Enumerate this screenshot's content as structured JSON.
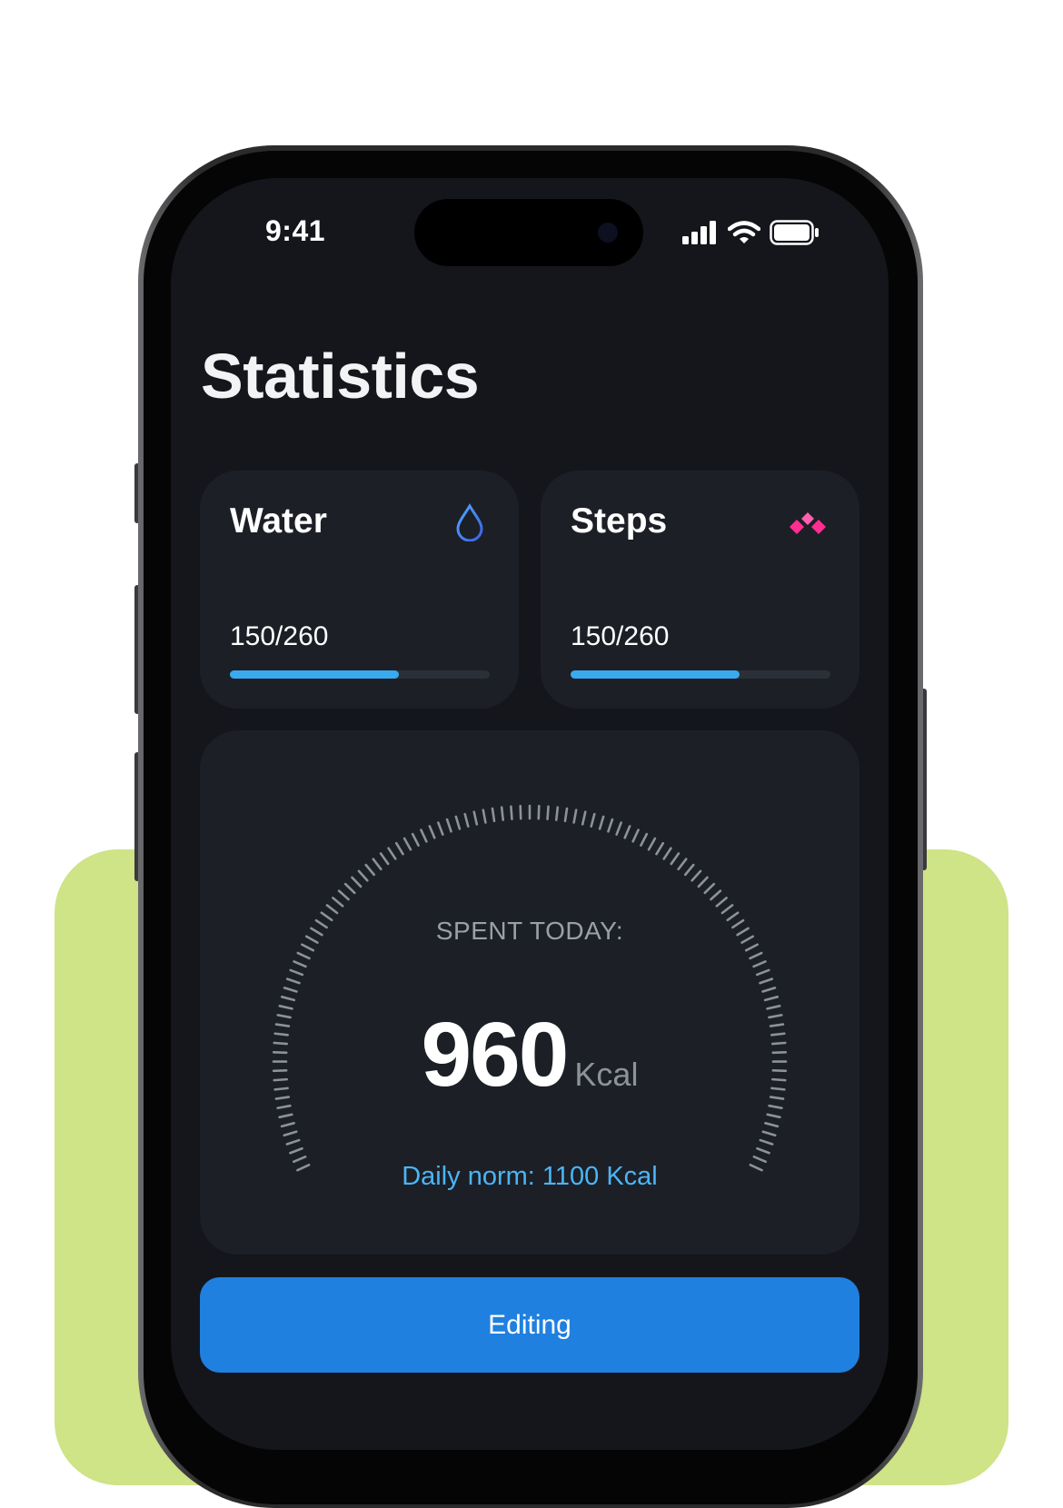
{
  "status_bar": {
    "time": "9:41"
  },
  "page": {
    "title": "Statistics"
  },
  "cards": [
    {
      "label": "Water",
      "icon": "water-drop-icon",
      "value": "150/260",
      "progress": 0.65
    },
    {
      "label": "Steps",
      "icon": "steps-diamond-icon",
      "value": "150/260",
      "progress": 0.65
    }
  ],
  "calories": {
    "spent_label": "SPENT TODAY:",
    "value": "960",
    "unit": "Kcal",
    "norm_text": "Daily norm: 1100 Kcal"
  },
  "actions": {
    "edit_label": "Editing"
  },
  "colors": {
    "accent_blue": "#1f80df",
    "progress_blue": "#39aaf0",
    "steps_pink": "#ff3d9a",
    "background_green": "#cfe387"
  }
}
